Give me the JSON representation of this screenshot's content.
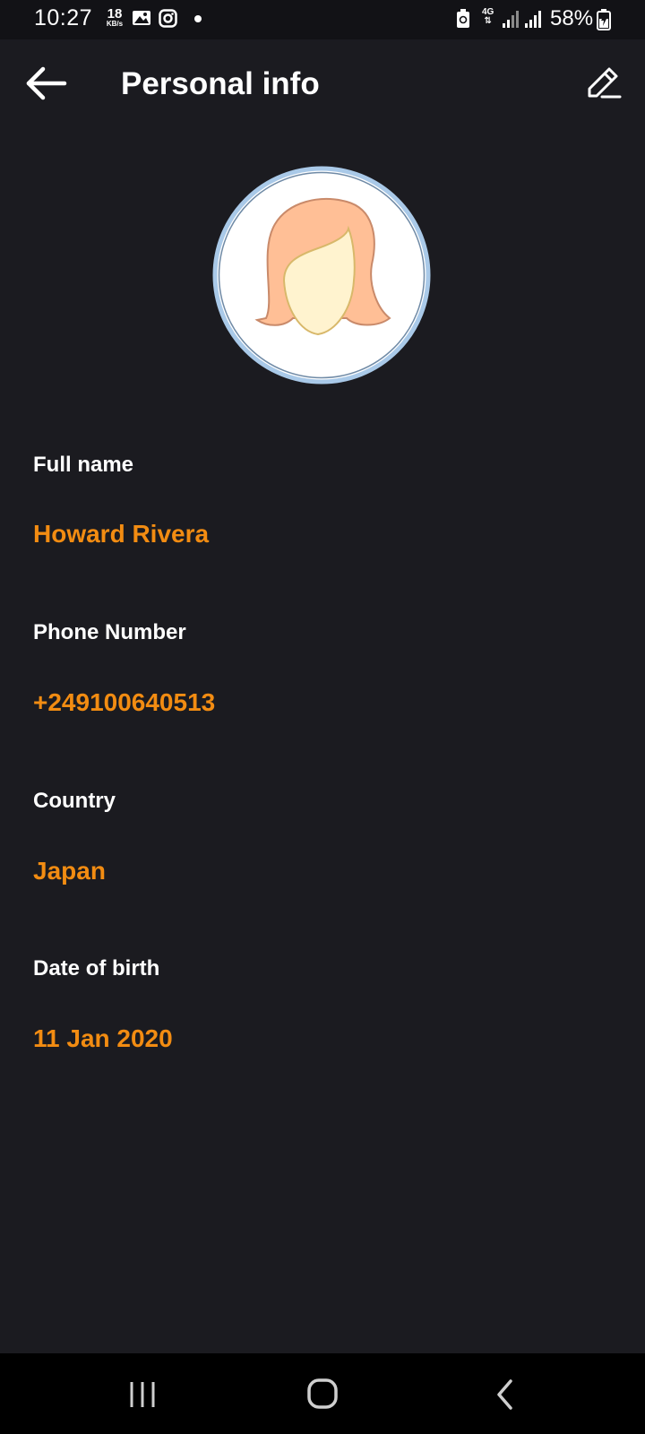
{
  "status_bar": {
    "time": "10:27",
    "speed_value": "18",
    "speed_unit": "KB/s",
    "network": "4G",
    "battery": "58%",
    "icons": [
      "gallery-icon",
      "instagram-icon",
      "notification-dot",
      "battery-saver-icon",
      "signal-icon",
      "signal-icon",
      "battery-icon"
    ]
  },
  "app_bar": {
    "title": "Personal info",
    "back_icon": "back-arrow-icon",
    "edit_icon": "edit-pencil-icon"
  },
  "profile": {
    "avatar_icon": "female-avatar-icon",
    "fields": [
      {
        "label": "Full name",
        "value": "Howard Rivera"
      },
      {
        "label": "Phone Number",
        "value": "+249100640513"
      },
      {
        "label": "Country",
        "value": "Japan"
      },
      {
        "label": "Date of birth",
        "value": "11 Jan 2020"
      }
    ]
  },
  "nav_bar": {
    "icons": [
      "recent-apps-icon",
      "home-icon",
      "back-icon"
    ]
  },
  "colors": {
    "background": "#1b1b20",
    "accent": "#f28c12",
    "text": "#ffffff"
  }
}
